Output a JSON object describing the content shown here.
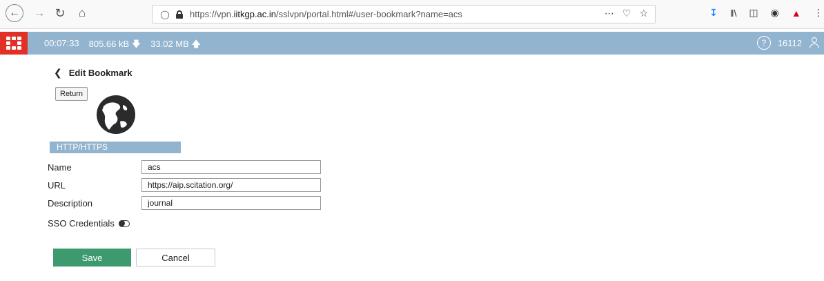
{
  "browser": {
    "url_prefix": "https://vpn.",
    "url_domain": "iitkgp.ac.in",
    "url_suffix": "/sslvpn/portal.html#/user-bookmark?name=acs",
    "icons": [
      "back-icon",
      "forward-icon",
      "reload-icon",
      "home-icon",
      "shield-icon",
      "lock-icon",
      "more-icon",
      "pocket-icon",
      "star-icon",
      "download-icon",
      "library-icon",
      "sidebar-icon",
      "account-icon",
      "addon-icon",
      "menu-icon"
    ]
  },
  "header": {
    "session_time": "00:07:33",
    "download_amount": "805.66 kB",
    "upload_amount": "33.02 MB",
    "user_id": "16112",
    "accent_color": "#93b4cf",
    "brand_color": "#e23027"
  },
  "page": {
    "title": "Edit Bookmark",
    "return_label": "Return",
    "section_title": "HTTP/HTTPS"
  },
  "form": {
    "name_label": "Name",
    "name_value": "acs",
    "url_label": "URL",
    "url_value": "https://aip.scitation.org/",
    "description_label": "Description",
    "description_value": "journal",
    "sso_label": "SSO Credentials",
    "sso_enabled": false
  },
  "actions": {
    "save_label": "Save",
    "cancel_label": "Cancel",
    "save_color": "#3c9a6e"
  }
}
